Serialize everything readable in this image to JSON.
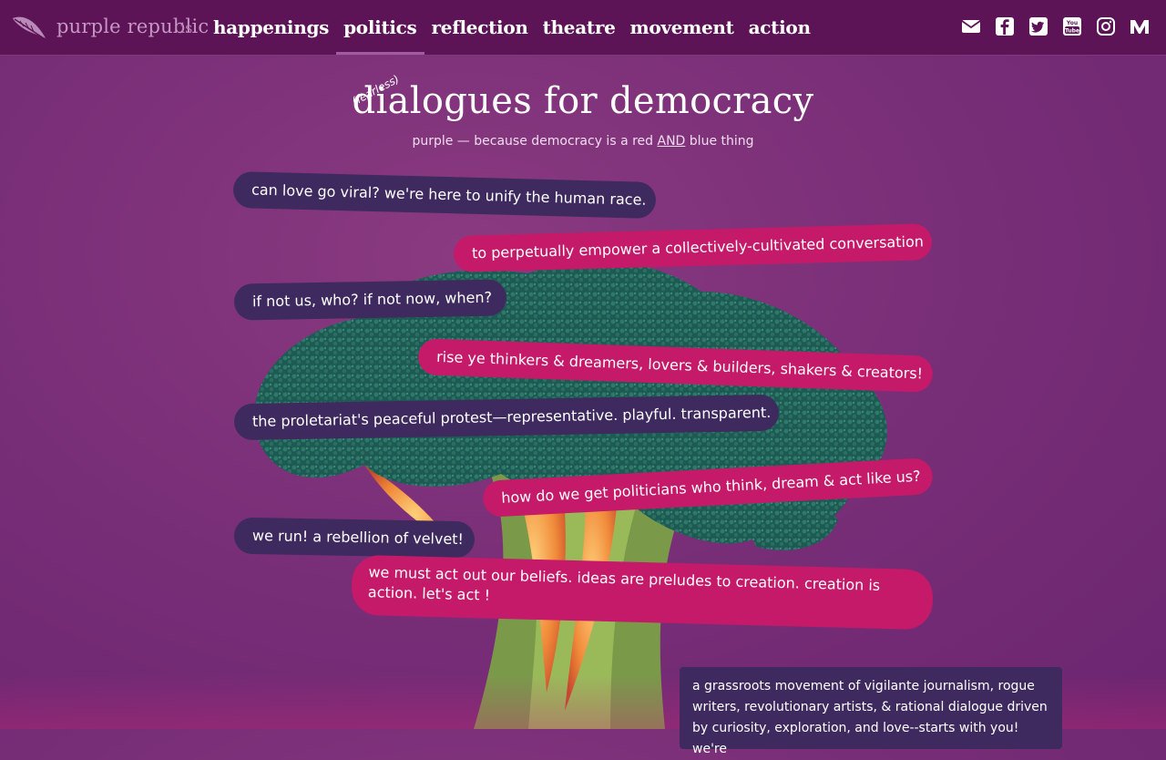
{
  "nav": {
    "brand": "purple republic",
    "is": "is",
    "items": [
      {
        "label": "happenings"
      },
      {
        "label": "politics",
        "active": true
      },
      {
        "label": "reflection"
      },
      {
        "label": "theatre"
      },
      {
        "label": "movement"
      },
      {
        "label": "action"
      }
    ],
    "socials": [
      "mail-icon",
      "facebook-icon",
      "twitter-icon",
      "youtube-icon",
      "instagram-icon",
      "medium-icon"
    ]
  },
  "hero": {
    "fearless": "(fearless)",
    "title": "dialogues for democracy",
    "subtitle_pre": "purple — because democracy is a red ",
    "subtitle_and": "AND",
    "subtitle_post": " blue thing"
  },
  "bubbles": [
    "can love go viral? we're here to unify the human race.",
    "to perpetually empower a collectively-cultivated conversation",
    "if not us, who? if not now, when?",
    "rise ye thinkers & dreamers, lovers & builders, shakers & creators!",
    "the proletariat's peaceful protest—representative. playful. transparent.",
    "how do we get politicians who think, dream & act like us?",
    "we run! a rebellion of velvet!",
    "we must act out our beliefs. ideas are preludes to creation. creation is action. let's act !"
  ],
  "info": "a grassroots movement of vigilante journalism, rogue writers, revolutionary artists, & rational dialogue driven by curiosity, exploration, and love--starts with you! we're",
  "colors": {
    "nav_bg": "#5c1456",
    "page_bg": "#7a2f78",
    "bubble_dark": "#3e2a5e",
    "bubble_pink": "#c41a69"
  }
}
